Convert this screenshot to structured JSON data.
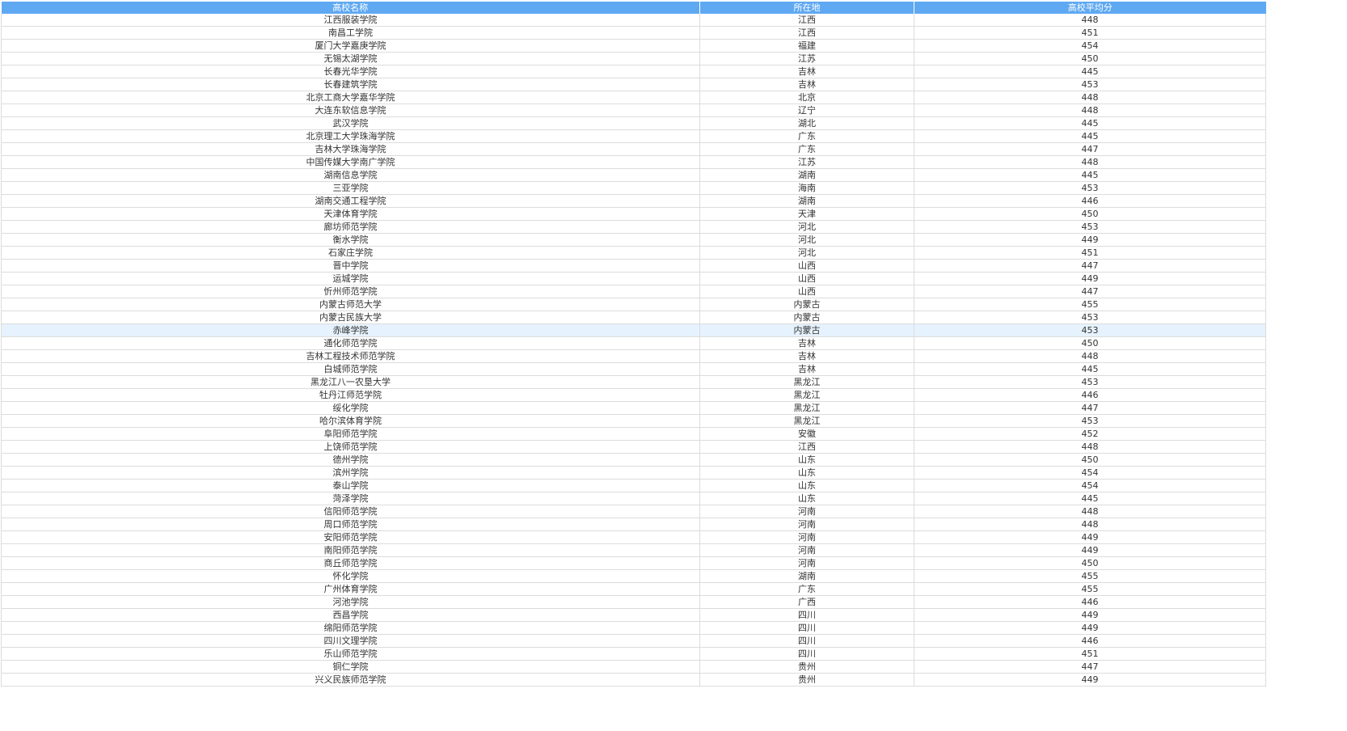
{
  "table": {
    "headers": [
      "高校名称",
      "所在地",
      "高校平均分"
    ],
    "highlight_row": 24,
    "rows": [
      [
        "江西服装学院",
        "江西",
        "448"
      ],
      [
        "南昌工学院",
        "江西",
        "451"
      ],
      [
        "厦门大学嘉庚学院",
        "福建",
        "454"
      ],
      [
        "无锡太湖学院",
        "江苏",
        "450"
      ],
      [
        "长春光华学院",
        "吉林",
        "445"
      ],
      [
        "长春建筑学院",
        "吉林",
        "453"
      ],
      [
        "北京工商大学嘉华学院",
        "北京",
        "448"
      ],
      [
        "大连东软信息学院",
        "辽宁",
        "448"
      ],
      [
        "武汉学院",
        "湖北",
        "445"
      ],
      [
        "北京理工大学珠海学院",
        "广东",
        "445"
      ],
      [
        "吉林大学珠海学院",
        "广东",
        "447"
      ],
      [
        "中国传媒大学南广学院",
        "江苏",
        "448"
      ],
      [
        "湖南信息学院",
        "湖南",
        "445"
      ],
      [
        "三亚学院",
        "海南",
        "453"
      ],
      [
        "湖南交通工程学院",
        "湖南",
        "446"
      ],
      [
        "天津体育学院",
        "天津",
        "450"
      ],
      [
        "廊坊师范学院",
        "河北",
        "453"
      ],
      [
        "衡水学院",
        "河北",
        "449"
      ],
      [
        "石家庄学院",
        "河北",
        "451"
      ],
      [
        "晋中学院",
        "山西",
        "447"
      ],
      [
        "运城学院",
        "山西",
        "449"
      ],
      [
        "忻州师范学院",
        "山西",
        "447"
      ],
      [
        "内蒙古师范大学",
        "内蒙古",
        "455"
      ],
      [
        "内蒙古民族大学",
        "内蒙古",
        "453"
      ],
      [
        "赤峰学院",
        "内蒙古",
        "453"
      ],
      [
        "通化师范学院",
        "吉林",
        "450"
      ],
      [
        "吉林工程技术师范学院",
        "吉林",
        "448"
      ],
      [
        "白城师范学院",
        "吉林",
        "445"
      ],
      [
        "黑龙江八一农垦大学",
        "黑龙江",
        "453"
      ],
      [
        "牡丹江师范学院",
        "黑龙江",
        "446"
      ],
      [
        "绥化学院",
        "黑龙江",
        "447"
      ],
      [
        "哈尔滨体育学院",
        "黑龙江",
        "453"
      ],
      [
        "阜阳师范学院",
        "安徽",
        "452"
      ],
      [
        "上饶师范学院",
        "江西",
        "448"
      ],
      [
        "德州学院",
        "山东",
        "450"
      ],
      [
        "滨州学院",
        "山东",
        "454"
      ],
      [
        "泰山学院",
        "山东",
        "454"
      ],
      [
        "菏泽学院",
        "山东",
        "445"
      ],
      [
        "信阳师范学院",
        "河南",
        "448"
      ],
      [
        "周口师范学院",
        "河南",
        "448"
      ],
      [
        "安阳师范学院",
        "河南",
        "449"
      ],
      [
        "南阳师范学院",
        "河南",
        "449"
      ],
      [
        "商丘师范学院",
        "河南",
        "450"
      ],
      [
        "怀化学院",
        "湖南",
        "455"
      ],
      [
        "广州体育学院",
        "广东",
        "455"
      ],
      [
        "河池学院",
        "广西",
        "446"
      ],
      [
        "西昌学院",
        "四川",
        "449"
      ],
      [
        "绵阳师范学院",
        "四川",
        "449"
      ],
      [
        "四川文理学院",
        "四川",
        "446"
      ],
      [
        "乐山师范学院",
        "四川",
        "451"
      ],
      [
        "铜仁学院",
        "贵州",
        "447"
      ],
      [
        "兴义民族师范学院",
        "贵州",
        "449"
      ]
    ]
  }
}
